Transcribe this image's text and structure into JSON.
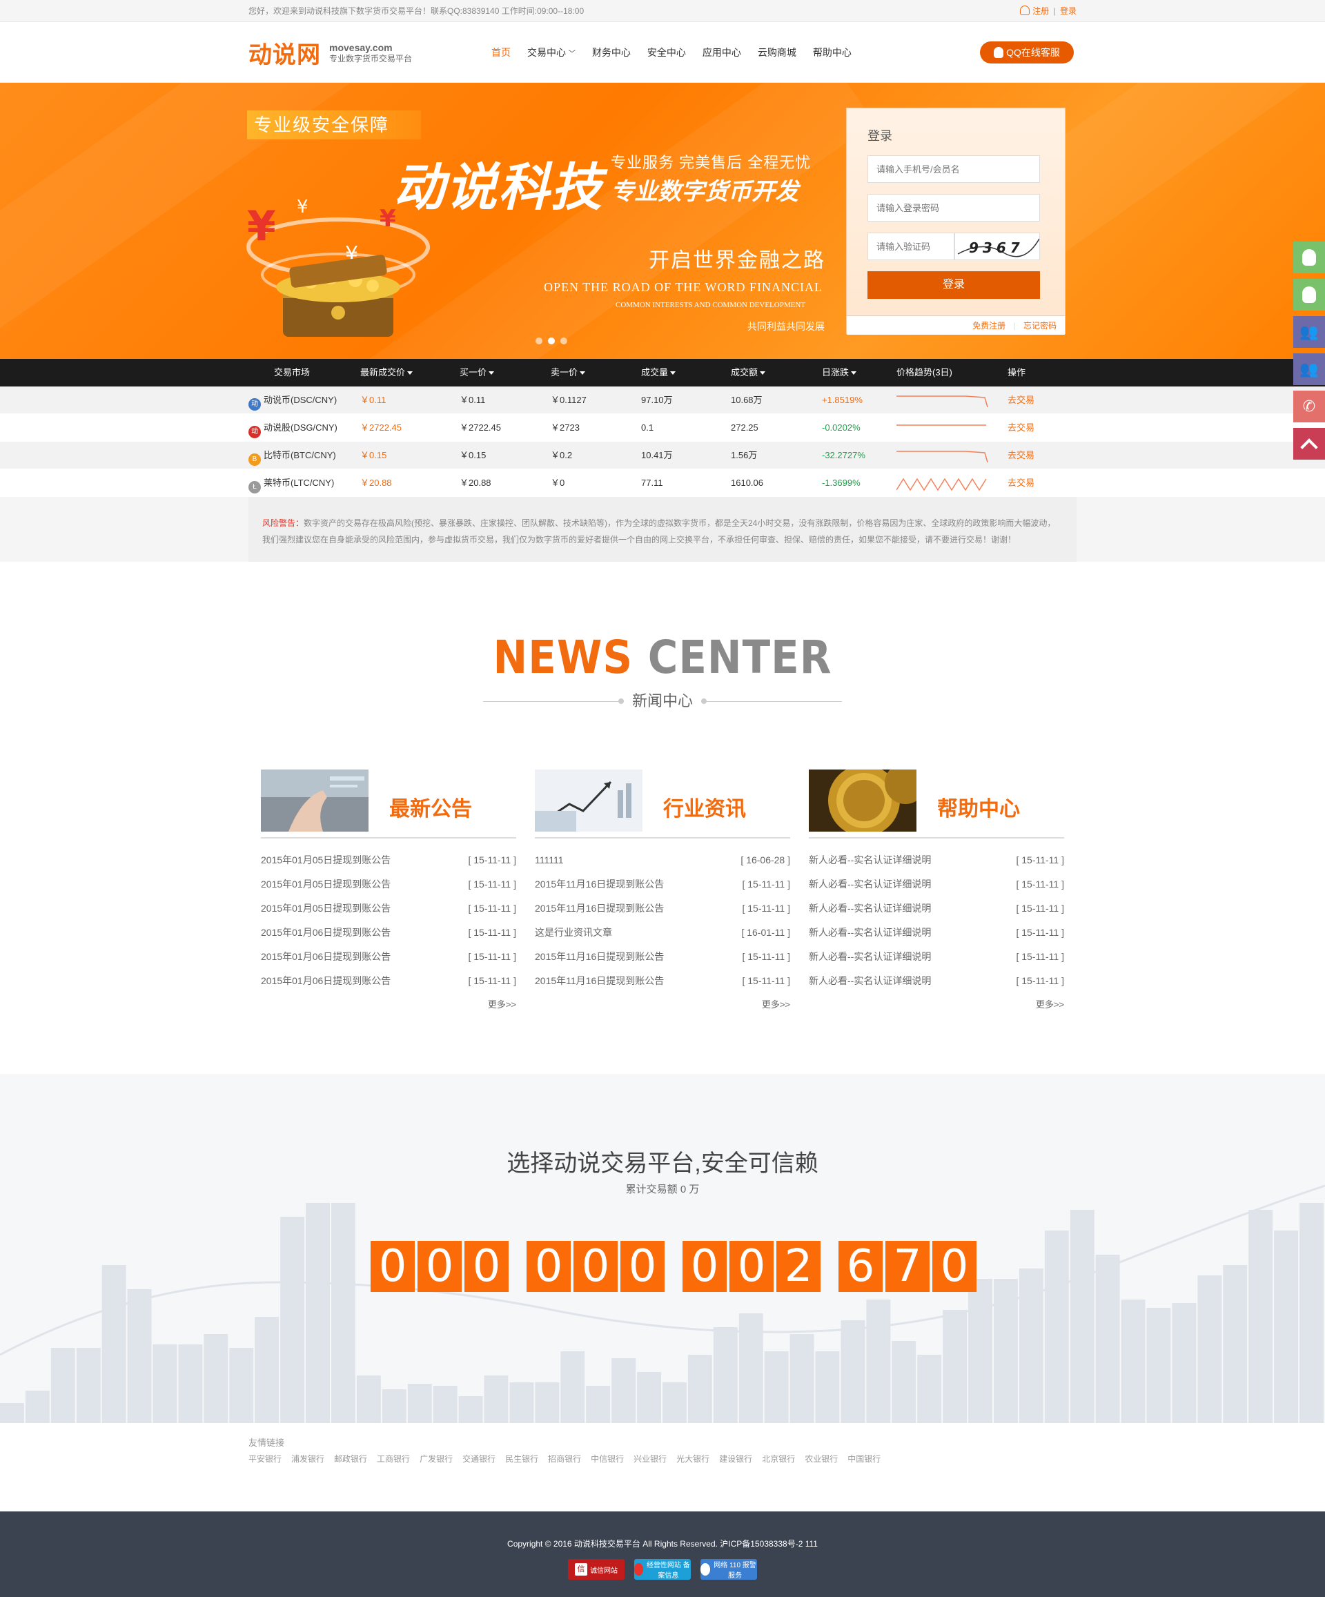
{
  "topbar": {
    "welcome": "您好，欢迎来到动说科技旗下数字货币交易平台！联系QQ:83839140 工作时间:09:00--18:00",
    "register": "注册",
    "sep": "|",
    "login": "登录"
  },
  "header": {
    "logo_cn": "动说网",
    "logo_en": "movesay.com",
    "logo_sub": "专业数字货币交易平台",
    "nav": [
      "首页",
      "交易中心",
      "财务中心",
      "安全中心",
      "应用中心",
      "云购商城",
      "帮助中心"
    ],
    "qq_button": "QQ在线客服"
  },
  "banner": {
    "tag": "专业级安全保障",
    "big": "动说科技",
    "slogan1": "专业服务  完美售后  全程无忧",
    "slogan2": "专业数字货币开发",
    "road": "开启世界金融之路",
    "eng": "OPEN THE ROAD OF THE WORD FINANCIAL",
    "eng2": "COMMON INTERESTS AND COMMON DEVELOPMENT",
    "cn_small": "共同利益共同发展"
  },
  "login": {
    "title": "登录",
    "account_placeholder": "请输入手机号/会员名",
    "password_placeholder": "请输入登录密码",
    "captcha_placeholder": "请输入验证码",
    "captcha_text": "9367",
    "submit": "登录",
    "free_register": "免费注册",
    "forgot": "忘记密码"
  },
  "market": {
    "headers": [
      "交易市场",
      "最新成交价",
      "买一价",
      "卖一价",
      "成交量",
      "成交额",
      "日涨跌",
      "价格趋势(3日)",
      "操作"
    ],
    "rows": [
      {
        "name": "动说币(DSC/CNY)",
        "last": "￥0.11",
        "buy": "￥0.11",
        "sell": "￥0.1127",
        "vol": "97.10万",
        "amount": "10.68万",
        "change": "+1.8519%",
        "dir": "up",
        "action": "去交易",
        "coin_color": "#3f78c7",
        "coin_glyph": "动"
      },
      {
        "name": "动说股(DSG/CNY)",
        "last": "￥2722.45",
        "buy": "￥2722.45",
        "sell": "￥2723",
        "vol": "0.1",
        "amount": "272.25",
        "change": "-0.0202%",
        "dir": "down",
        "action": "去交易",
        "coin_color": "#d9302a",
        "coin_glyph": "动"
      },
      {
        "name": "比特币(BTC/CNY)",
        "last": "￥0.15",
        "buy": "￥0.15",
        "sell": "￥0.2",
        "vol": "10.41万",
        "amount": "1.56万",
        "change": "-32.2727%",
        "dir": "down",
        "action": "去交易",
        "coin_color": "#f39b1d",
        "coin_glyph": "B"
      },
      {
        "name": "莱特币(LTC/CNY)",
        "last": "￥20.88",
        "buy": "￥20.88",
        "sell": "￥0",
        "vol": "77.11",
        "amount": "1610.06",
        "change": "-1.3699%",
        "dir": "down",
        "action": "去交易",
        "coin_color": "#9a9a9a",
        "coin_glyph": "Ł"
      }
    ]
  },
  "risk": {
    "label": "风险警告：",
    "text": "数字资产的交易存在极高风险(预挖、暴涨暴跌、庄家操控、团队解散、技术缺陷等)，作为全球的虚拟数字货币，都是全天24小时交易，没有涨跌限制，价格容易因为庄家、全球政府的政策影响而大幅波动，我们强烈建议您在自身能承受的风险范围内，参与虚拟货币交易，我们仅为数字货币的爱好者提供一个自由的网上交换平台，不承担任何审查、担保、赔偿的责任，如果您不能接受，请不要进行交易！谢谢！"
  },
  "news": {
    "title_o": "NEWS",
    "title_g": "CENTER",
    "subtitle": "新闻中心",
    "columns": [
      {
        "title": "最新公告",
        "items": [
          {
            "t": "2015年01月05日提现到账公告",
            "d": "[ 15-11-11 ]"
          },
          {
            "t": "2015年01月05日提现到账公告",
            "d": "[ 15-11-11 ]"
          },
          {
            "t": "2015年01月05日提现到账公告",
            "d": "[ 15-11-11 ]"
          },
          {
            "t": "2015年01月06日提现到账公告",
            "d": "[ 15-11-11 ]"
          },
          {
            "t": "2015年01月06日提现到账公告",
            "d": "[ 15-11-11 ]"
          },
          {
            "t": "2015年01月06日提现到账公告",
            "d": "[ 15-11-11 ]"
          }
        ],
        "more": "更多>>"
      },
      {
        "title": "行业资讯",
        "items": [
          {
            "t": "111111",
            "d": "[ 16-06-28 ]"
          },
          {
            "t": "2015年11月16日提现到账公告",
            "d": "[ 15-11-11 ]"
          },
          {
            "t": "2015年11月16日提现到账公告",
            "d": "[ 15-11-11 ]"
          },
          {
            "t": "这是行业资讯文章",
            "d": "[ 16-01-11 ]"
          },
          {
            "t": "2015年11月16日提现到账公告",
            "d": "[ 15-11-11 ]"
          },
          {
            "t": "2015年11月16日提现到账公告",
            "d": "[ 15-11-11 ]"
          }
        ],
        "more": "更多>>"
      },
      {
        "title": "帮助中心",
        "items": [
          {
            "t": "新人必看--实名认证详细说明",
            "d": "[ 15-11-11 ]"
          },
          {
            "t": "新人必看--实名认证详细说明",
            "d": "[ 15-11-11 ]"
          },
          {
            "t": "新人必看--实名认证详细说明",
            "d": "[ 15-11-11 ]"
          },
          {
            "t": "新人必看--实名认证详细说明",
            "d": "[ 15-11-11 ]"
          },
          {
            "t": "新人必看--实名认证详细说明",
            "d": "[ 15-11-11 ]"
          },
          {
            "t": "新人必看--实名认证详细说明",
            "d": "[ 15-11-11 ]"
          }
        ],
        "more": "更多>>"
      }
    ]
  },
  "stats": {
    "headline": "选择动说交易平台,安全可信赖",
    "accumulated": "累计交易额 0 万",
    "digits": [
      "0",
      "0",
      "0",
      "0",
      "0",
      "0",
      "0",
      "0",
      "2",
      "6",
      "7",
      "0"
    ]
  },
  "friend_links": {
    "title": "友情链接",
    "items": [
      "平安银行",
      "浦发银行",
      "邮政银行",
      "工商银行",
      "广发银行",
      "交通银行",
      "民生银行",
      "招商银行",
      "中信银行",
      "兴业银行",
      "光大银行",
      "建设银行",
      "北京银行",
      "农业银行",
      "中国银行"
    ]
  },
  "footer": {
    "copyright": "Copyright © 2016  动说科技交易平台  All Rights Reserved.  沪ICP备15038338号-2  111",
    "badges": [
      "诚信网站",
      "经营性网站 备案信息",
      "网络 110 报警服务"
    ]
  },
  "colors": {
    "accent": "#f26b0f",
    "up": "#f26b0f",
    "down": "#20a04c",
    "footer_bg": "#3c4350"
  }
}
